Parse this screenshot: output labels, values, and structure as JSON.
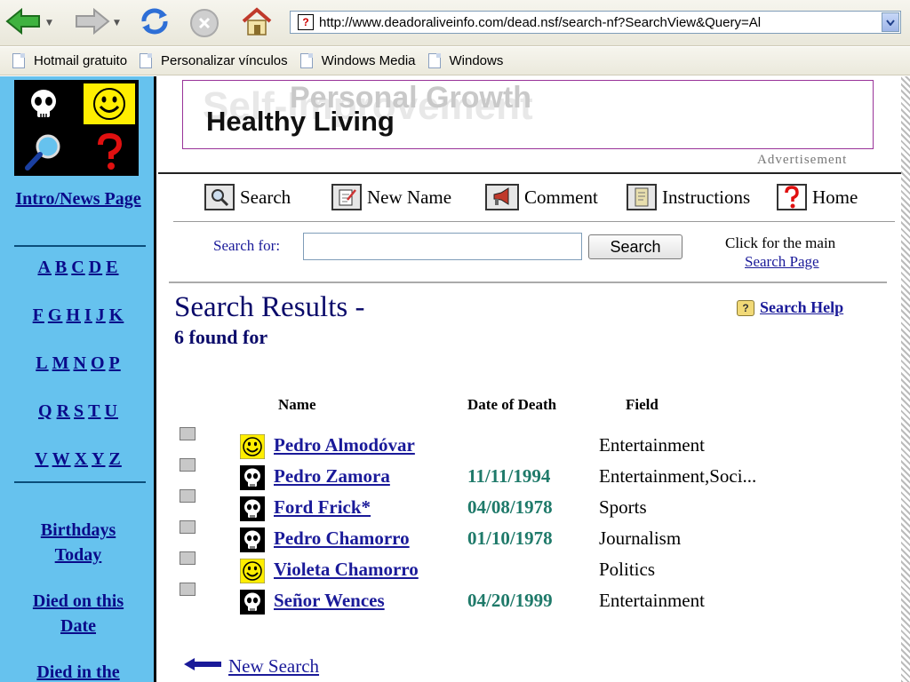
{
  "browser": {
    "url": "http://www.deadoraliveinfo.com/dead.nsf/search-nf?SearchView&Query=Al",
    "links": [
      "Hotmail gratuito",
      "Personalizar vínculos",
      "Windows Media",
      "Windows"
    ]
  },
  "nav": {
    "intro": "Intro/News Page",
    "letters": [
      [
        "A",
        "B",
        "C",
        "D",
        "E"
      ],
      [
        "F",
        "G",
        "H",
        "I",
        "J",
        "K"
      ],
      [
        "L",
        "M",
        "N",
        "O",
        "P"
      ],
      [
        "Q",
        "R",
        "S",
        "T",
        "U"
      ],
      [
        "V",
        "W",
        "X",
        "Y",
        "Z"
      ]
    ],
    "birthdays": "Birthdays Today",
    "died_on": "Died on this Date",
    "died_in": "Died in the"
  },
  "ad": {
    "ghost1": "Self-Improvement",
    "ghost2": "Personal Growth",
    "main": "Healthy Living",
    "label": "Advertisement"
  },
  "toolbar": {
    "search": "Search",
    "new_name": "New Name",
    "comment": "Comment",
    "instructions": "Instructions",
    "home": "Home"
  },
  "search": {
    "label": "Search for:",
    "value": "",
    "button": "Search",
    "click_main": "Click for the main",
    "search_page": "Search Page"
  },
  "results": {
    "title": "Search Results -",
    "count": "6 found for",
    "help": "Search Help",
    "columns": {
      "name": "Name",
      "date": "Date of Death",
      "field": "Field"
    },
    "rows": [
      {
        "status": "alive",
        "name": "Pedro Almodóvar",
        "date": "",
        "field": "Entertainment"
      },
      {
        "status": "dead",
        "name": "Pedro Zamora",
        "date": "11/11/1994",
        "field": "Entertainment,Soci..."
      },
      {
        "status": "dead",
        "name": "Ford Frick*",
        "date": "04/08/1978",
        "field": "Sports"
      },
      {
        "status": "dead",
        "name": "Pedro Chamorro",
        "date": "01/10/1978",
        "field": "Journalism"
      },
      {
        "status": "alive",
        "name": "Violeta Chamorro",
        "date": "",
        "field": "Politics"
      },
      {
        "status": "dead",
        "name": "Señor Wences",
        "date": "04/20/1999",
        "field": "Entertainment"
      }
    ],
    "new_search": "New Search"
  }
}
